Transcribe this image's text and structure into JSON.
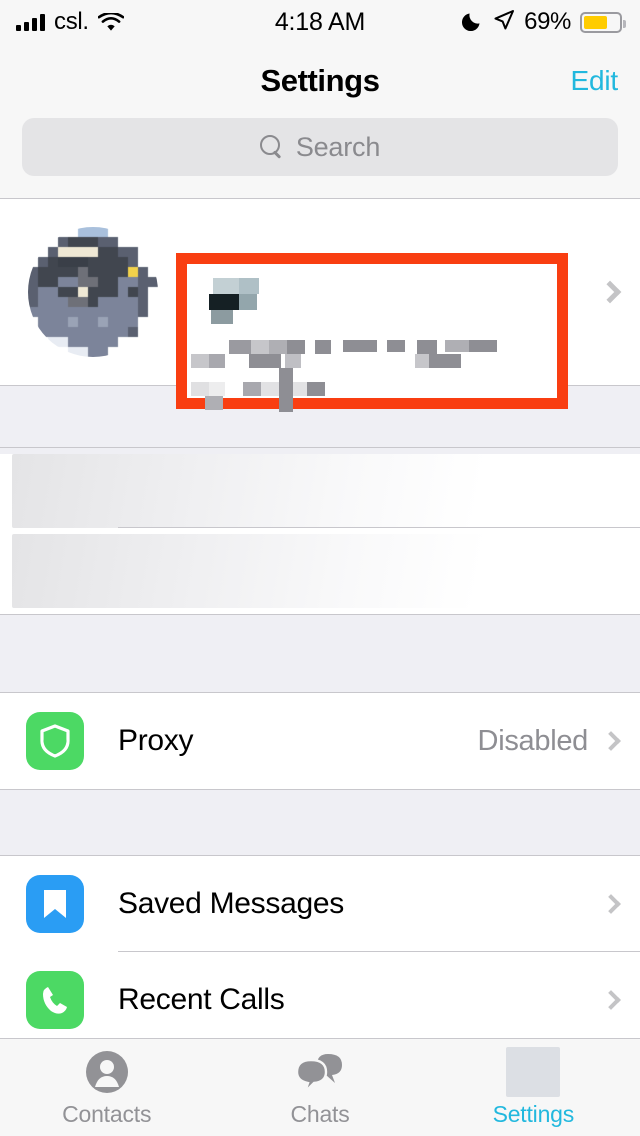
{
  "status_bar": {
    "carrier": "csl.",
    "signal_icon": "signal-bars-icon",
    "wifi_icon": "wifi-icon",
    "time": "4:18 AM",
    "dnd_icon": "moon-icon",
    "location_icon": "location-arrow-icon",
    "battery_percent": "69%",
    "battery_level": 69,
    "battery_color": "#FFCC00"
  },
  "nav": {
    "title": "Settings",
    "edit_label": "Edit",
    "accent_color": "#22B8DE"
  },
  "search": {
    "placeholder": "Search",
    "icon": "search-icon"
  },
  "profile": {
    "avatar_icon": "user-avatar-image",
    "redacted": true,
    "annotation_box_color": "#F93E11",
    "name_line": "",
    "phone_line": "",
    "username_line": "",
    "chevron_icon": "chevron-right-icon"
  },
  "redacted_section": {
    "rows": [
      {
        "name": "redacted-row-1",
        "label": ""
      },
      {
        "name": "redacted-row-2",
        "label": ""
      }
    ]
  },
  "proxy_section": {
    "rows": [
      {
        "label": "Proxy",
        "value": "Disabled",
        "icon": "shield-icon",
        "icon_color": "#4CD964",
        "chevron_icon": "chevron-right-icon"
      }
    ]
  },
  "messages_section": {
    "rows": [
      {
        "label": "Saved Messages",
        "value": "",
        "icon": "bookmark-icon",
        "icon_color": "#2A9DF4",
        "chevron_icon": "chevron-right-icon"
      },
      {
        "label": "Recent Calls",
        "value": "",
        "icon": "phone-icon",
        "icon_color": "#4CD964",
        "chevron_icon": "chevron-right-icon"
      }
    ]
  },
  "tab_bar": {
    "active_color": "#22B8DE",
    "inactive_color": "#929296",
    "tabs": [
      {
        "label": "Contacts",
        "icon": "contacts-person-icon",
        "active": false
      },
      {
        "label": "Chats",
        "icon": "chats-bubbles-icon",
        "active": false
      },
      {
        "label": "Settings",
        "icon": "settings-gear-icon",
        "active": true,
        "icon_redacted": true
      }
    ]
  }
}
